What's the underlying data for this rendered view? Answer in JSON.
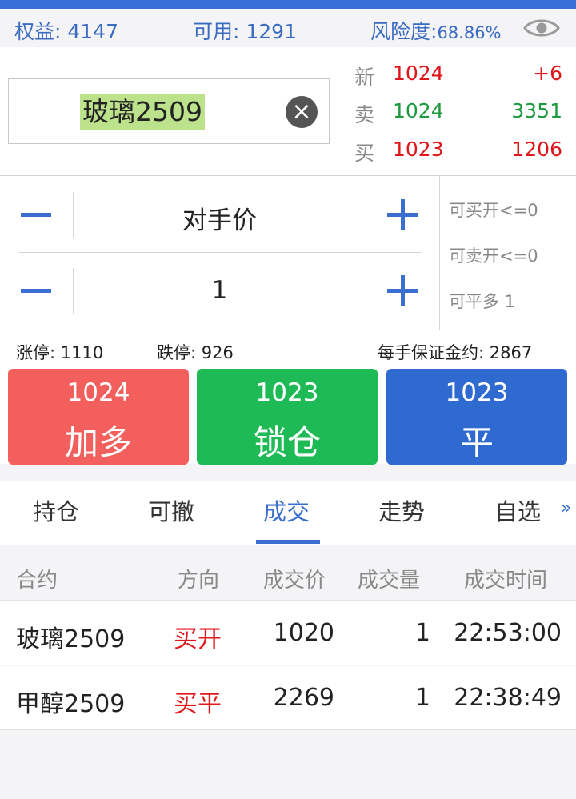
{
  "account": {
    "equity": "权益: 4147",
    "available": "可用: 1291",
    "risk_label": "风险度:",
    "risk_value": "68.86%",
    "eye_icon": "eye-icon"
  },
  "symbol": {
    "name": "玻璃2509",
    "clear_icon": "clear-icon"
  },
  "quote": {
    "latest": {
      "label": "新",
      "price": "1024",
      "value": "+6"
    },
    "ask": {
      "label": "卖",
      "price": "1024",
      "value": "3351"
    },
    "bid": {
      "label": "买",
      "price": "1023",
      "value": "1206"
    }
  },
  "order": {
    "price_mode": "对手价",
    "quantity": "1",
    "can_buy_open": "可买开<=0",
    "can_sell_open": "可卖开<=0",
    "can_close_long": "可平多 1"
  },
  "limits": {
    "limit_up": "涨停: 1110",
    "limit_down": "跌停: 926",
    "margin": "每手保证金约: 2867"
  },
  "actions": {
    "long": {
      "price": "1024",
      "label": "加多"
    },
    "lock": {
      "price": "1023",
      "label": "锁仓"
    },
    "close": {
      "price": "1023",
      "label": "平"
    }
  },
  "tabs": [
    "持仓",
    "可撤",
    "成交",
    "走势",
    "自选"
  ],
  "tabs_more": "»",
  "active_tab": "成交",
  "trades": {
    "headers": [
      "合约",
      "方向",
      "成交价",
      "成交量",
      "成交时间"
    ],
    "rows": [
      [
        "玻璃2509",
        "买开",
        "1020",
        "1",
        "22:53:00"
      ],
      [
        "甲醇2509",
        "买平",
        "2269",
        "1",
        "22:38:49"
      ]
    ]
  },
  "colors": {
    "accent": "#3a6fd0",
    "up": "#e0161b",
    "down": "#1d9a3f",
    "btn_long": "#f25f5c",
    "btn_lock": "#1eba56",
    "btn_close": "#2f6ad1"
  }
}
